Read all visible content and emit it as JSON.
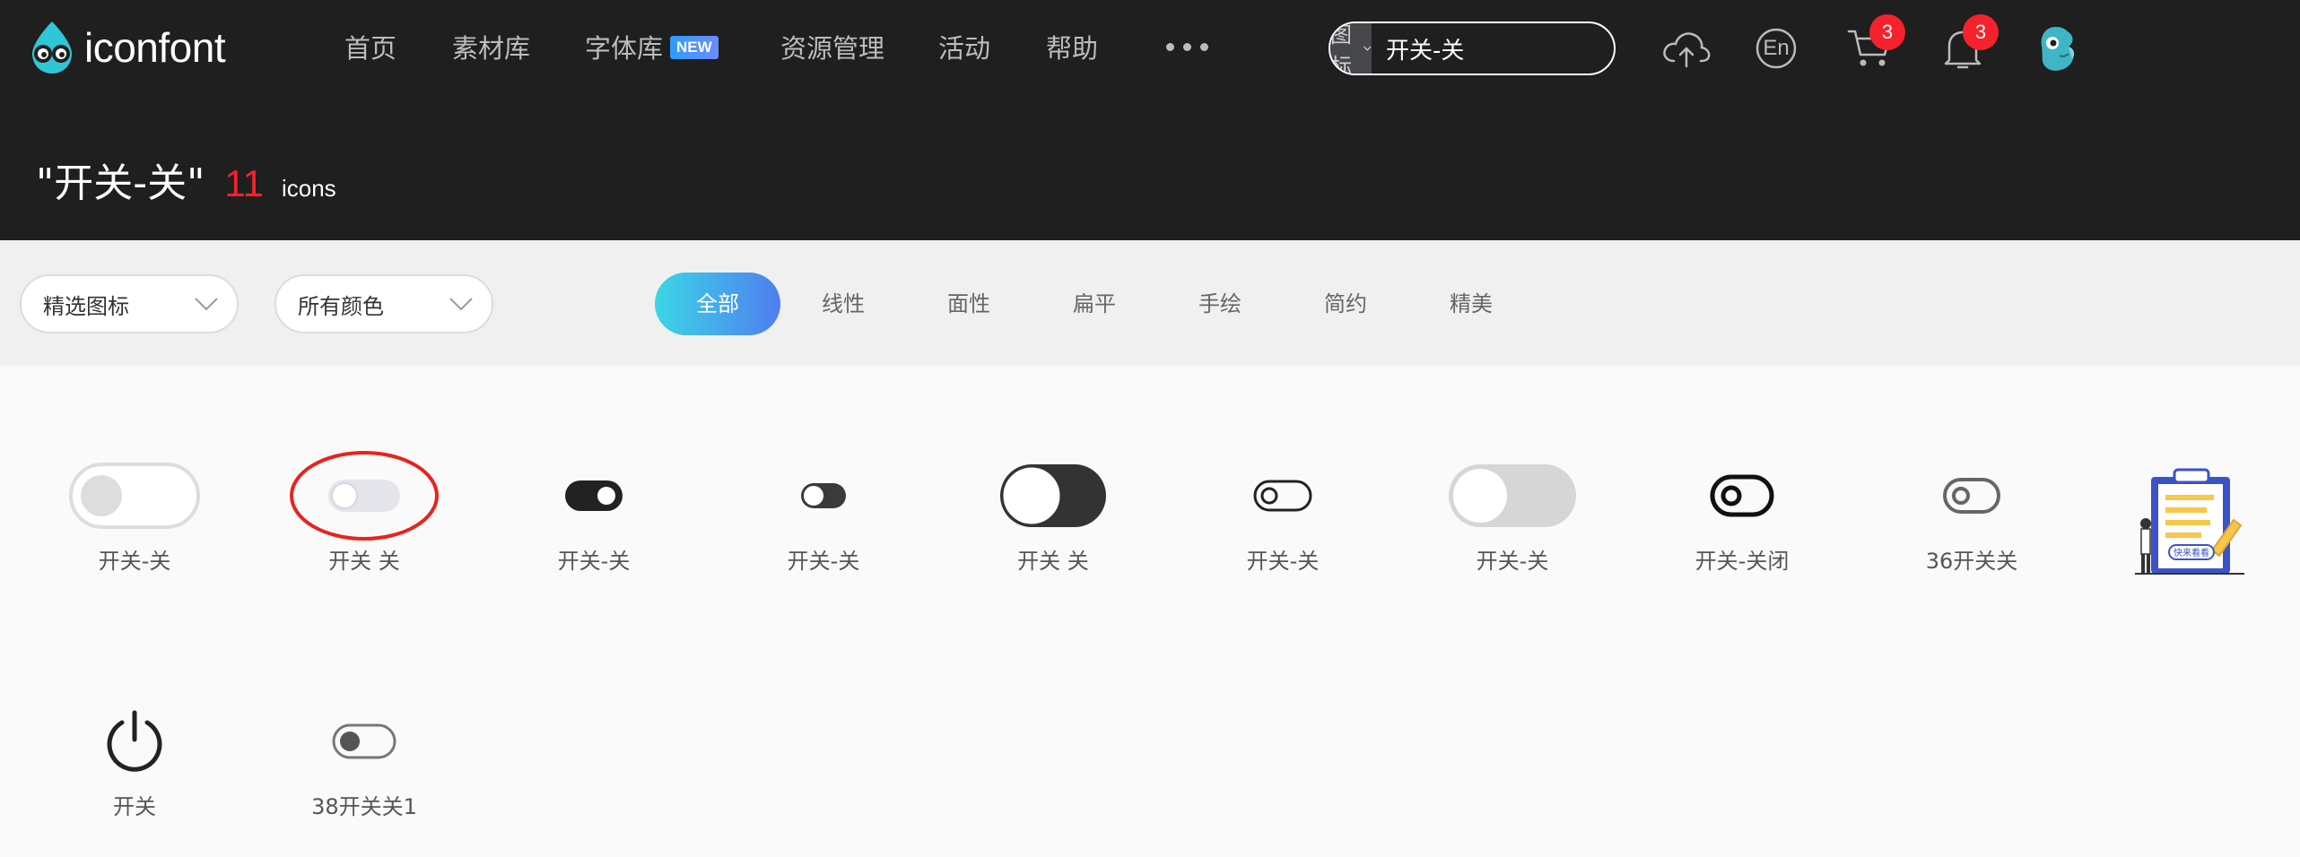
{
  "brand": {
    "name": "iconfont"
  },
  "nav": {
    "items": [
      "首页",
      "素材库",
      "字体库",
      "资源管理",
      "活动",
      "帮助"
    ],
    "new_badge": "NEW"
  },
  "search": {
    "type": "图标",
    "value": "开关-关"
  },
  "toolbar": {
    "lang_label": "En",
    "cart_count": "3",
    "notice_count": "3"
  },
  "result": {
    "title": "\"开关-关\"",
    "count": "11",
    "unit": "icons"
  },
  "filters": {
    "dropdown_select": "精选图标",
    "dropdown_color": "所有颜色"
  },
  "tabs": [
    "全部",
    "线性",
    "面性",
    "扁平",
    "手绘",
    "简约",
    "精美"
  ],
  "icons": [
    {
      "label": "开关-关",
      "icon": "toggle-off-light-icon"
    },
    {
      "label": "开关 关",
      "icon": "toggle-off-gray-icon",
      "highlighted": true
    },
    {
      "label": "开关-关",
      "icon": "toggle-black-icon"
    },
    {
      "label": "开关-关",
      "icon": "toggle-small-icon"
    },
    {
      "label": "开关 关",
      "icon": "toggle-dark-large-icon"
    },
    {
      "label": "开关-关",
      "icon": "toggle-outline-icon"
    },
    {
      "label": "开关-关",
      "icon": "toggle-gray-large-icon"
    },
    {
      "label": "开关-关闭",
      "icon": "toggle-bold-outline-icon"
    },
    {
      "label": "36开关关",
      "icon": "toggle-gray-outline-icon"
    },
    {
      "label": "开关",
      "icon": "power-icon"
    },
    {
      "label": "38开关关1",
      "icon": "toggle-gray-knob-icon"
    }
  ],
  "ad": {
    "text": "快来看看"
  },
  "colors": {
    "accent_red": "#f5222d",
    "tab_gradient_start": "#3bd6e6",
    "tab_gradient_end": "#4f7ef0",
    "header_bg": "#1f1f1f"
  }
}
